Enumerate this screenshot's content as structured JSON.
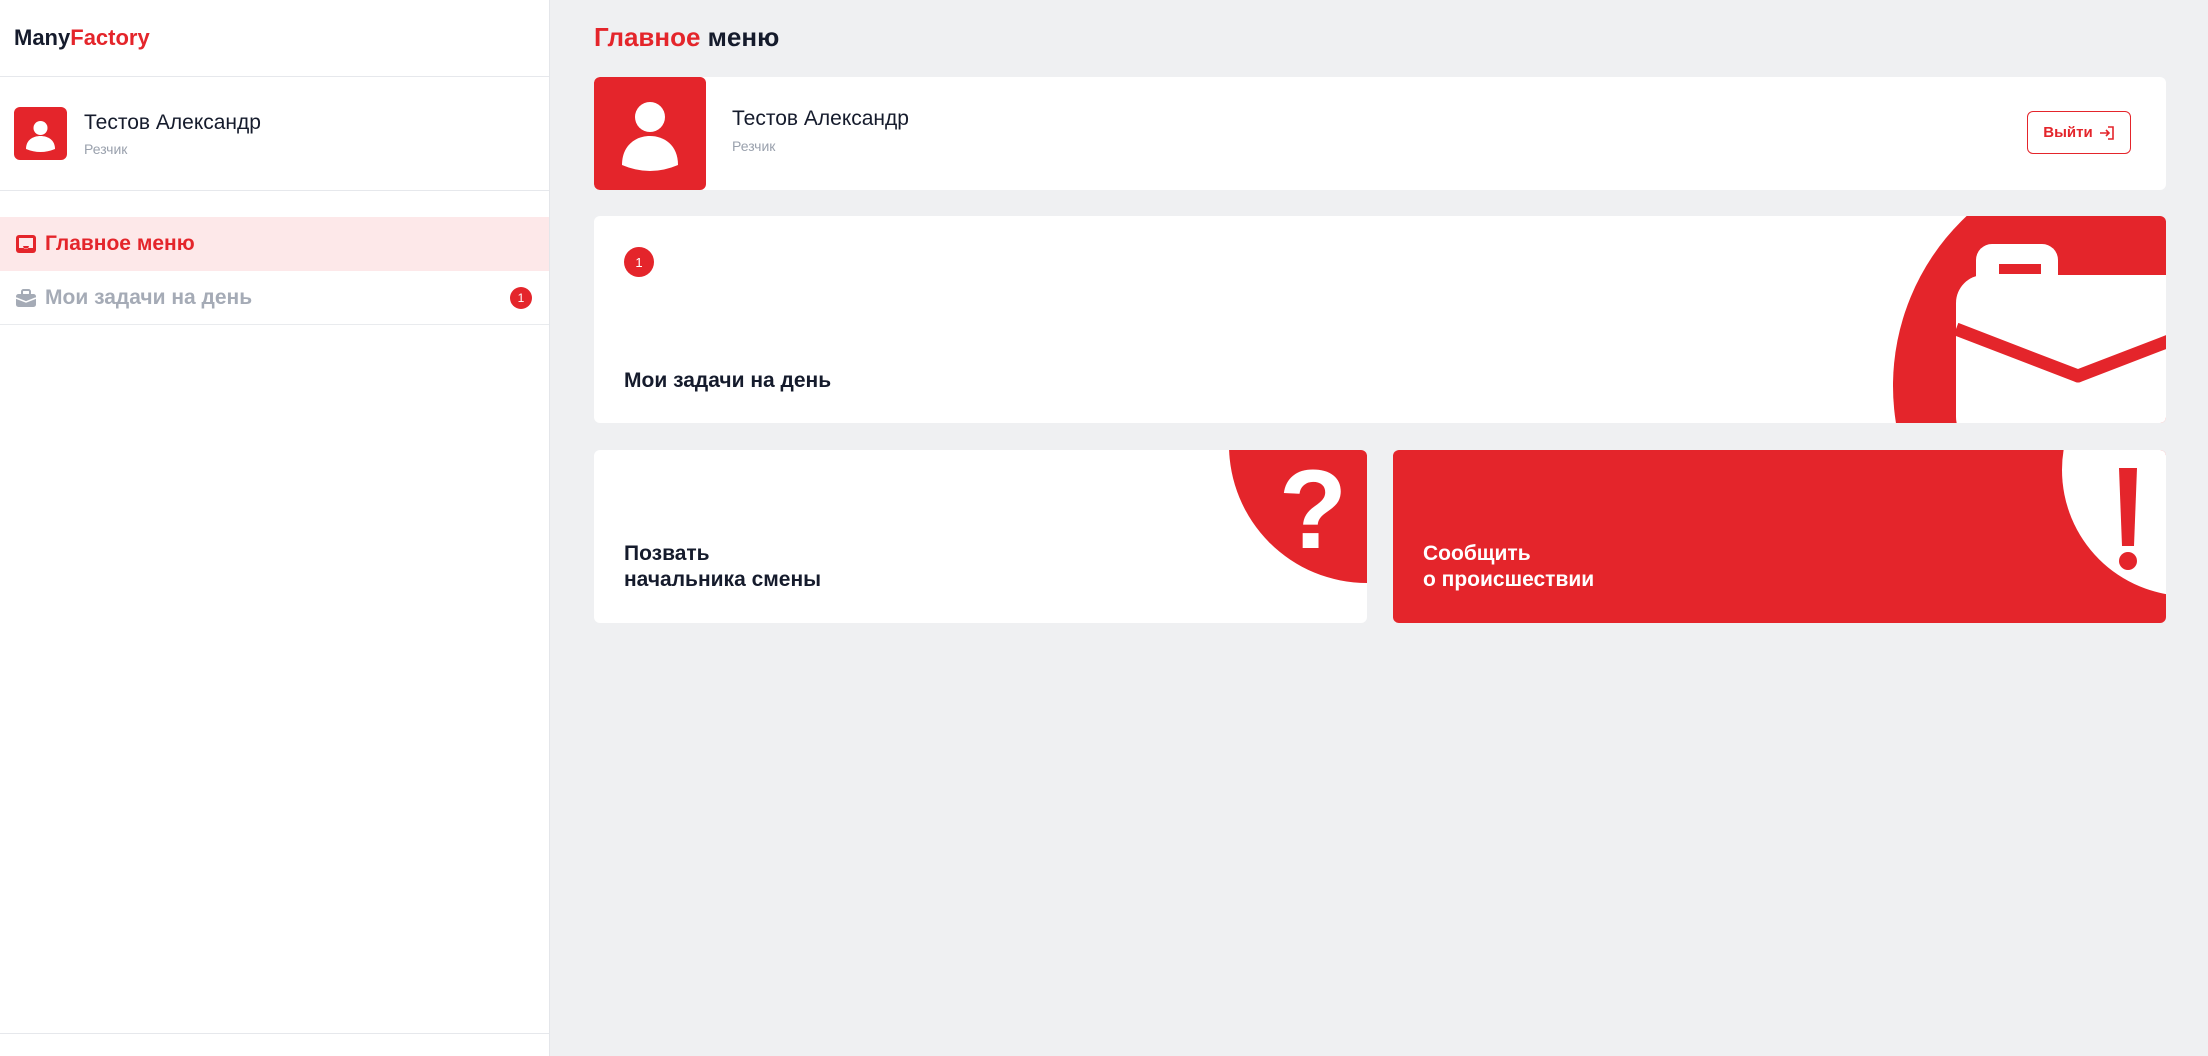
{
  "brand": {
    "part1": "Many",
    "part2": "Factory"
  },
  "user": {
    "name": "Тестов Александр",
    "role": "Резчик"
  },
  "nav": {
    "items": [
      {
        "label": "Главное меню",
        "icon": "inbox-icon",
        "active": true
      },
      {
        "label": "Мои задачи на день",
        "icon": "briefcase-icon",
        "badge": "1"
      }
    ]
  },
  "page": {
    "title_accent": "Главное",
    "title_rest": " меню"
  },
  "profile": {
    "name": "Тестов Александр",
    "role": "Резчик",
    "logout_label": "Выйти",
    "logout_icon": "sign-in-icon"
  },
  "cards": {
    "tasks": {
      "badge": "1",
      "title": "Мои задачи на день",
      "icon": "briefcase-icon"
    },
    "call": {
      "line1": "Позвать",
      "line2": "начальника смены",
      "icon": "question-icon"
    },
    "incident": {
      "line1": "Сообщить",
      "line2": "о происшествии",
      "icon": "exclamation-icon"
    }
  },
  "colors": {
    "accent": "#e4252b",
    "background": "#eff0f2",
    "muted": "#9aa1ad",
    "active_bg": "#fde8e9"
  }
}
